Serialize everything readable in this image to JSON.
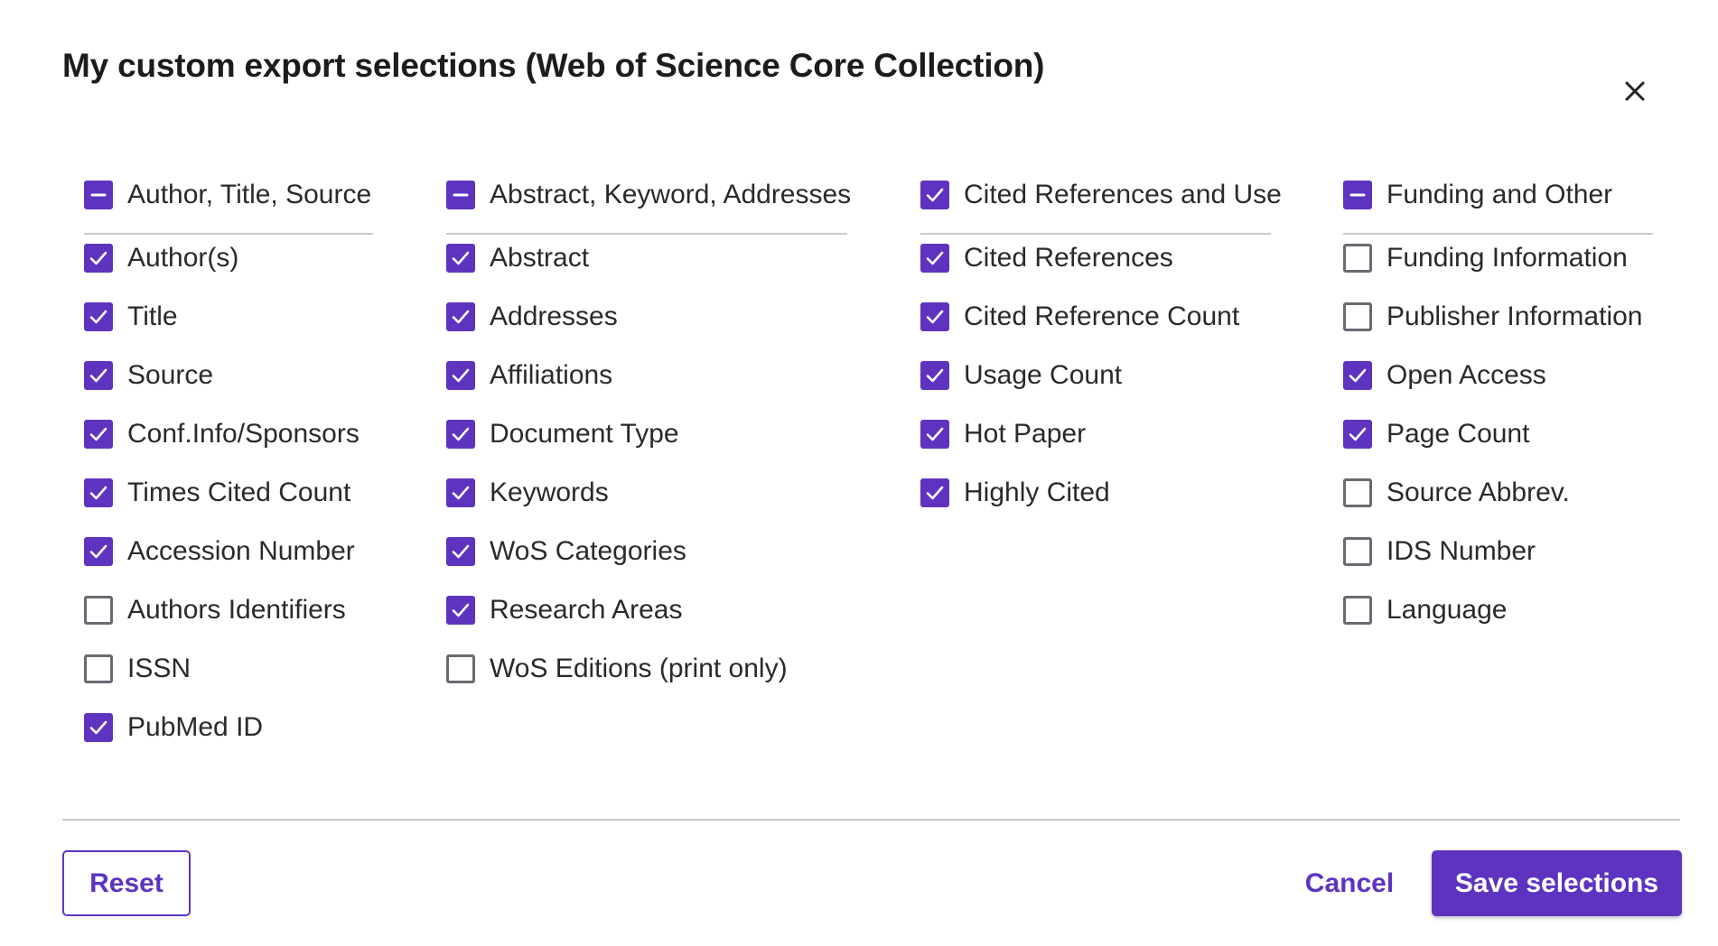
{
  "dialog": {
    "title": "My custom export selections (Web of Science Core Collection)",
    "close_icon": "close-icon"
  },
  "columns": [
    {
      "header": {
        "label": "Author, Title, Source",
        "state": "partial"
      },
      "items": [
        {
          "label": "Author(s)",
          "checked": true
        },
        {
          "label": "Title",
          "checked": true
        },
        {
          "label": "Source",
          "checked": true
        },
        {
          "label": "Conf.Info/Sponsors",
          "checked": true
        },
        {
          "label": "Times Cited Count",
          "checked": true
        },
        {
          "label": "Accession Number",
          "checked": true
        },
        {
          "label": "Authors Identifiers",
          "checked": false
        },
        {
          "label": "ISSN",
          "checked": false
        },
        {
          "label": "PubMed ID",
          "checked": true
        }
      ]
    },
    {
      "header": {
        "label": "Abstract, Keyword, Addresses",
        "state": "partial"
      },
      "items": [
        {
          "label": "Abstract",
          "checked": true
        },
        {
          "label": "Addresses",
          "checked": true
        },
        {
          "label": "Affiliations",
          "checked": true
        },
        {
          "label": "Document Type",
          "checked": true
        },
        {
          "label": "Keywords",
          "checked": true
        },
        {
          "label": "WoS Categories",
          "checked": true
        },
        {
          "label": "Research Areas",
          "checked": true
        },
        {
          "label": "WoS Editions (print only)",
          "checked": false
        }
      ]
    },
    {
      "header": {
        "label": "Cited References and Use",
        "state": "checked"
      },
      "items": [
        {
          "label": "Cited References",
          "checked": true
        },
        {
          "label": "Cited Reference Count",
          "checked": true
        },
        {
          "label": "Usage Count",
          "checked": true
        },
        {
          "label": "Hot Paper",
          "checked": true
        },
        {
          "label": "Highly Cited",
          "checked": true
        }
      ]
    },
    {
      "header": {
        "label": "Funding and Other",
        "state": "partial"
      },
      "items": [
        {
          "label": "Funding Information",
          "checked": false
        },
        {
          "label": "Publisher Information",
          "checked": false
        },
        {
          "label": "Open Access",
          "checked": true
        },
        {
          "label": "Page Count",
          "checked": true
        },
        {
          "label": "Source Abbrev.",
          "checked": false
        },
        {
          "label": "IDS Number",
          "checked": false
        },
        {
          "label": "Language",
          "checked": false
        }
      ]
    }
  ],
  "footer": {
    "reset_label": "Reset",
    "cancel_label": "Cancel",
    "save_label": "Save selections"
  },
  "colors": {
    "accent": "#5e33bf",
    "unchecked_border": "#6a6a72",
    "divider": "#c9c9cf"
  }
}
